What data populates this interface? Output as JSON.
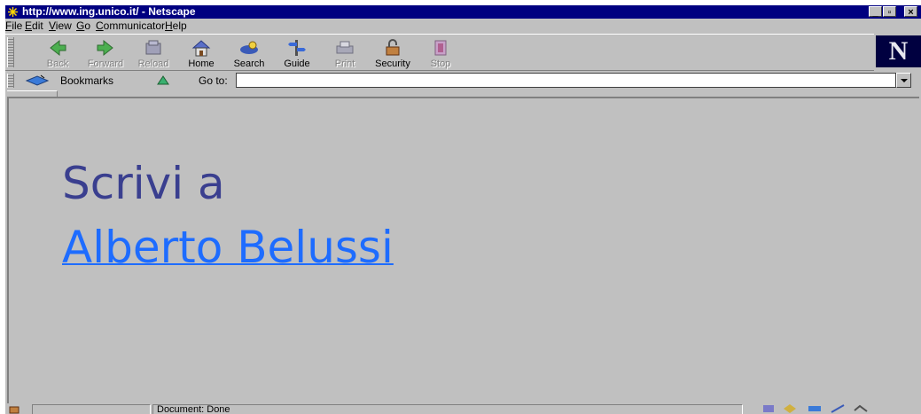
{
  "window": {
    "title": "http://www.ing.unico.it/ - Netscape",
    "minimize_label": "_",
    "maximize_label": "▫",
    "close_label": "×"
  },
  "menu": [
    "File",
    "Edit",
    "View",
    "Go",
    "Communicator",
    "Help"
  ],
  "toolbar": {
    "buttons": [
      {
        "label": "Back",
        "icon": "back-icon",
        "enabled": false
      },
      {
        "label": "Forward",
        "icon": "forward-icon",
        "enabled": false
      },
      {
        "label": "Reload",
        "icon": "reload-icon",
        "enabled": false
      },
      {
        "label": "Home",
        "icon": "home-icon",
        "enabled": true
      },
      {
        "label": "Search",
        "icon": "search-icon",
        "enabled": true
      },
      {
        "label": "Guide",
        "icon": "guide-icon",
        "enabled": true
      },
      {
        "label": "Print",
        "icon": "print-icon",
        "enabled": false
      },
      {
        "label": "Security",
        "icon": "security-icon",
        "enabled": true
      },
      {
        "label": "Stop",
        "icon": "stop-icon",
        "enabled": false
      }
    ],
    "logo": "N"
  },
  "location": {
    "bookmarks_label": "Bookmarks",
    "goto_label": "Go to:",
    "url_value": ""
  },
  "content": {
    "line1": "Scrivi a",
    "link_text": "Alberto Belussi",
    "text_color": "#3a3f8f",
    "link_color": "#1e6cff"
  },
  "status": {
    "text": "Document: Done"
  }
}
